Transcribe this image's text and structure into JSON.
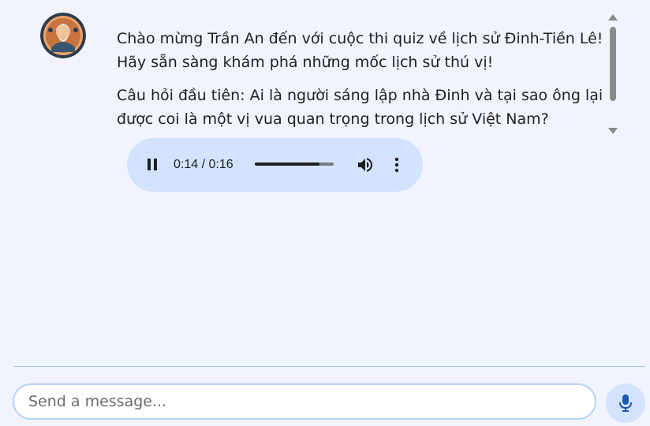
{
  "chat": {
    "messages": [
      {
        "role": "assistant",
        "paragraphs": [
          "Chào mừng Trần An đến với cuộc thi quiz về lịch sử Đinh-Tiền Lê! Hãy sẵn sàng khám phá những mốc lịch sử thú vị!",
          "Câu hỏi đầu tiên: Ai là người sáng lập nhà Đinh và tại sao ông lại được coi là một vị vua quan trọng trong lịch sử Việt Nam?"
        ]
      }
    ]
  },
  "audio_player": {
    "time_display": "0:14 / 0:16",
    "progress_fraction": 0.82,
    "state": "playing"
  },
  "composer": {
    "placeholder": "Send a message..."
  },
  "icons": {
    "avatar": "bot-avatar-portrait",
    "pause": "pause-icon",
    "volume": "volume-icon",
    "more": "more-vert-icon",
    "mic": "microphone-icon"
  },
  "colors": {
    "background": "#f1f4fe",
    "accent": "#d3e3fd",
    "mic": "#1a56b4"
  }
}
